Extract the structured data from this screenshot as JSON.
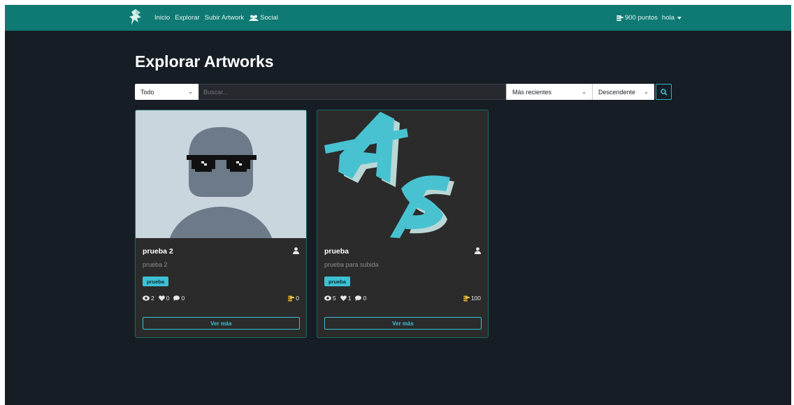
{
  "nav": {
    "links": [
      "Inicio",
      "Explorar",
      "Subir Artwork",
      "Social"
    ],
    "points": "900 puntos",
    "user": "hola"
  },
  "page": {
    "title": "Explorar Artworks"
  },
  "filters": {
    "category": "Todo",
    "search_placeholder": "Buscar...",
    "sort": "Más recientes",
    "order": "Descendente"
  },
  "cards": [
    {
      "title": "prueba 2",
      "description": "prueba 2",
      "tag": "prueba",
      "views": "2",
      "likes": "0",
      "comments": "0",
      "points": "0",
      "button": "Ver más"
    },
    {
      "title": "prueba",
      "description": "prueba para subida",
      "tag": "prueba",
      "views": "5",
      "likes": "1",
      "comments": "0",
      "points": "100",
      "button": "Ver más"
    }
  ],
  "colors": {
    "navbar": "#0f7a73",
    "background": "#171d25",
    "accent": "#3dc0d3",
    "card": "#2b2b2b"
  }
}
